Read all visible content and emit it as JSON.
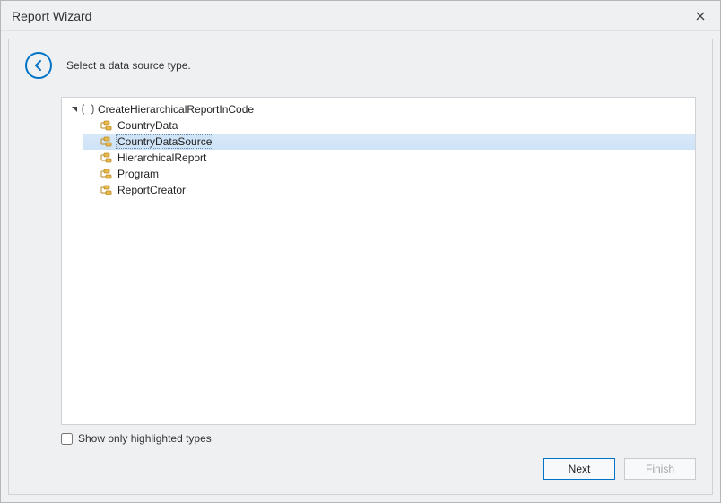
{
  "window": {
    "title": "Report Wizard"
  },
  "instruction": "Select a data source type.",
  "tree": {
    "root_label": "CreateHierarchicalReportInCode",
    "items": [
      {
        "label": "CountryData",
        "selected": false
      },
      {
        "label": "CountryDataSource",
        "selected": true
      },
      {
        "label": "HierarchicalReport",
        "selected": false
      },
      {
        "label": "Program",
        "selected": false
      },
      {
        "label": "ReportCreator",
        "selected": false
      }
    ]
  },
  "checkbox": {
    "label": "Show only highlighted types",
    "checked": false
  },
  "buttons": {
    "next": "Next",
    "finish": "Finish"
  }
}
